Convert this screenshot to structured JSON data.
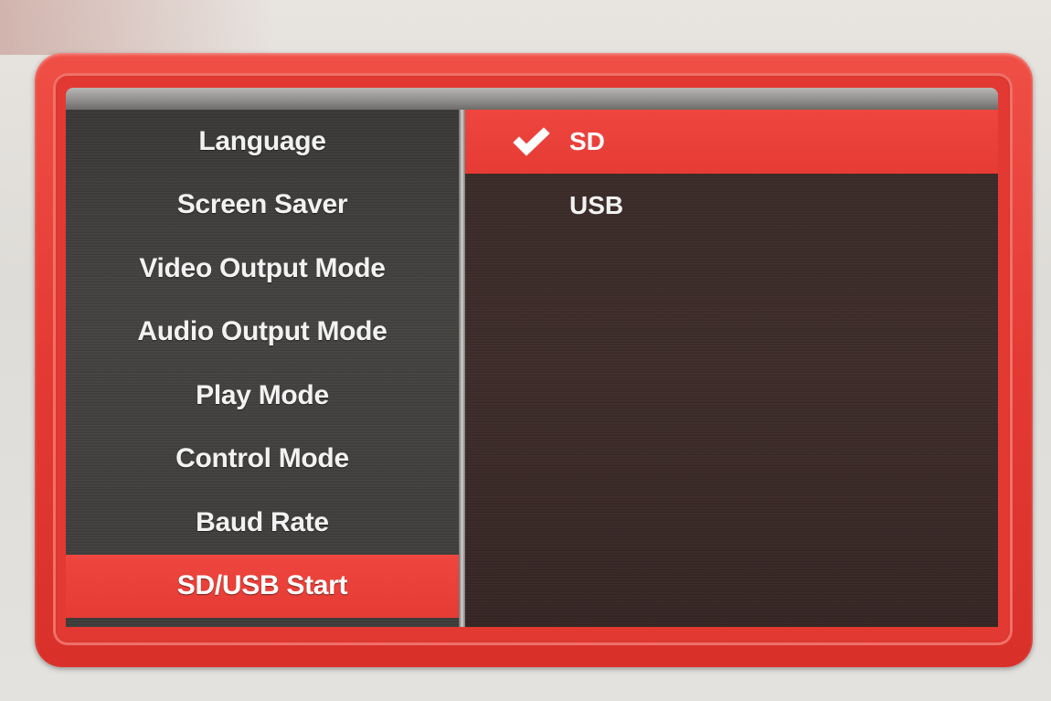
{
  "settings_menu": {
    "items": [
      {
        "label": "Language"
      },
      {
        "label": "Screen Saver"
      },
      {
        "label": "Video Output Mode"
      },
      {
        "label": "Audio Output Mode"
      },
      {
        "label": "Play Mode"
      },
      {
        "label": "Control Mode"
      },
      {
        "label": "Baud Rate"
      },
      {
        "label": "SD/USB Start",
        "selected": true
      }
    ]
  },
  "options": {
    "items": [
      {
        "label": "SD",
        "checked": true,
        "icon": "checkmark-icon"
      },
      {
        "label": "USB",
        "checked": false
      }
    ]
  },
  "colors": {
    "accent": "#e53b34",
    "frame": "#e43a33",
    "left_panel": "#3e3c3a",
    "right_panel": "#3a2b28",
    "text": "#f2f2f2"
  }
}
